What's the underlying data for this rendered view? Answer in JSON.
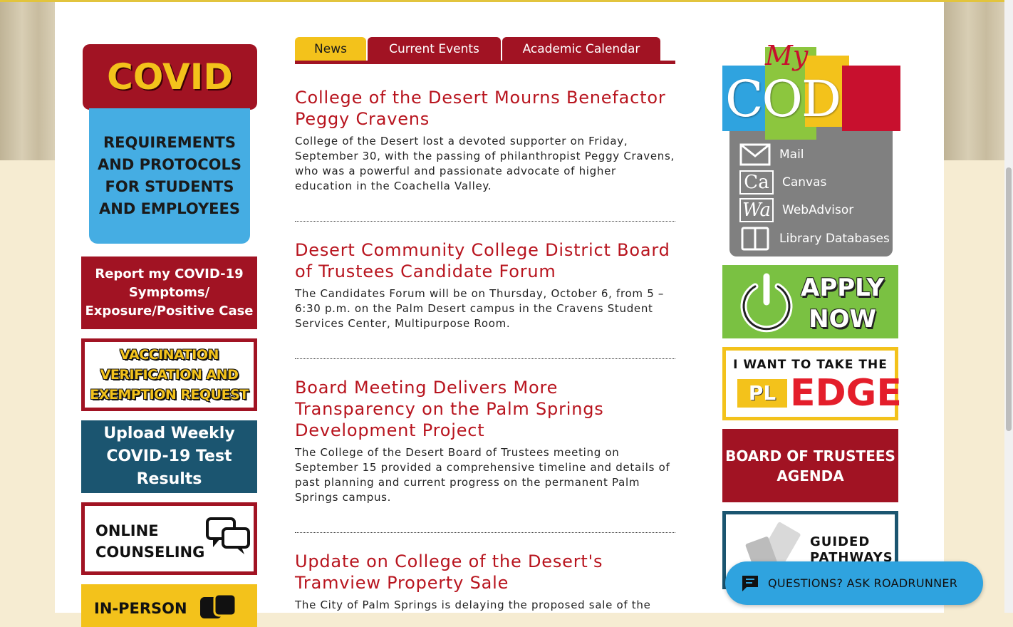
{
  "left_tiles": {
    "covid_title": "COVID",
    "covid_sub": "REQUIREMENTS AND PROTOCOLS FOR STUDENTS AND EMPLOYEES",
    "report": "Report my COVID-19 Symptoms/ Exposure/Positive Case",
    "vaccination": "VACCINATION VERIFICATION AND EXEMPTION REQUEST",
    "upload": "Upload Weekly COVID-19 Test Results",
    "counseling_line1": "ONLINE",
    "counseling_line2": "COUNSELING",
    "inperson": "IN-PERSON"
  },
  "tabs": {
    "news": "News",
    "events": "Current Events",
    "calendar": "Academic Calendar"
  },
  "articles": [
    {
      "title": "College of the Desert Mourns Benefactor Peggy Cravens",
      "summary": "College of the Desert lost a devoted supporter on Friday, September 30, with the passing of philanthropist Peggy Cravens, who was a powerful and passionate advocate of higher education in the Coachella Valley."
    },
    {
      "title": "Desert Community College District Board of Trustees Candidate Forum",
      "summary": "The Candidates Forum will be on Thursday, October 6, from 5 – 6:30 p.m. on the Palm Desert campus in the Cravens Student Services Center, Multipurpose Room."
    },
    {
      "title": "Board Meeting Delivers More Transparency on the Palm Springs Development Project",
      "summary": "The College of the Desert Board of Trustees meeting on September 15 provided a comprehensive timeline and details of past planning and current progress on the permanent Palm Springs campus."
    },
    {
      "title": "Update on College of the Desert's Tramview Property Sale",
      "summary": "The City of Palm Springs is delaying the proposed sale of the"
    }
  ],
  "mycod": {
    "my": "My",
    "word": "COD",
    "links": [
      {
        "icon": "mail-icon",
        "abbr": "",
        "label": "Mail"
      },
      {
        "icon": "canvas-icon",
        "abbr": "Ca",
        "label": "Canvas"
      },
      {
        "icon": "webadvisor-icon",
        "abbr": "Wa",
        "label": "WebAdvisor"
      },
      {
        "icon": "book-icon",
        "abbr": "",
        "label": "Library Databases"
      }
    ]
  },
  "right_tiles": {
    "apply_line1": "APPLY",
    "apply_line2": "NOW",
    "edge_top": "I WANT TO TAKE THE",
    "edge_pl": "PL",
    "edge_word": "EDGE",
    "board": "BOARD OF TRUSTEES AGENDA",
    "guided_line1": "GUIDED",
    "guided_line2": "PATHWAYS"
  },
  "chat": {
    "label": "QUESTIONS? ASK ROADRUNNER",
    "icon": "chat-bubble-icon"
  },
  "colors": {
    "crimson": "#a11323",
    "gold": "#f3c21b",
    "link_red": "#b8141e",
    "teal": "#1b5570",
    "sky": "#2fa3df",
    "green": "#7ac142"
  }
}
